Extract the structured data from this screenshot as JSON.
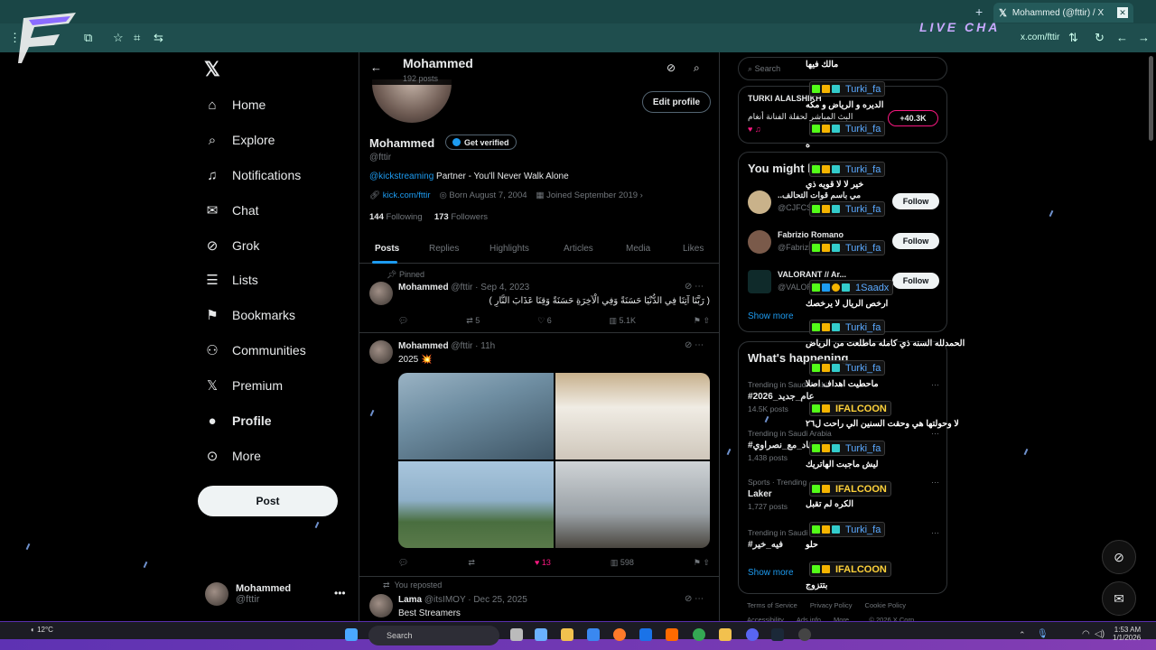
{
  "browser": {
    "tab_title": "Mohammed (@fttir) / X",
    "url": "x.com/fttir",
    "overlay_brand": "LIVE CHA"
  },
  "nav": {
    "items": [
      {
        "label": "Home",
        "icon": "home-icon"
      },
      {
        "label": "Explore",
        "icon": "search-icon"
      },
      {
        "label": "Notifications",
        "icon": "bell-icon"
      },
      {
        "label": "Chat",
        "icon": "mail-icon"
      },
      {
        "label": "Grok",
        "icon": "grok-icon"
      },
      {
        "label": "Lists",
        "icon": "list-icon"
      },
      {
        "label": "Bookmarks",
        "icon": "bookmark-icon"
      },
      {
        "label": "Communities",
        "icon": "communities-icon"
      },
      {
        "label": "Premium",
        "icon": "x-icon"
      },
      {
        "label": "Profile",
        "icon": "person-icon"
      },
      {
        "label": "More",
        "icon": "more-icon"
      }
    ],
    "post_label": "Post",
    "account_name": "Mohammed",
    "account_handle": "@fttir"
  },
  "profile": {
    "header_name": "Mohammed",
    "header_posts": "192 posts",
    "edit_label": "Edit profile",
    "name": "Mohammed",
    "verify_label": "Get verified",
    "handle": "@fttir",
    "bio_link": "@kickstreaming",
    "bio_text": " Partner - You'll Never Walk Alone",
    "website": "kick.com/fttir",
    "born": "Born August 7, 2004",
    "joined": "Joined September 2019",
    "following_count": "144",
    "following_label": " Following",
    "followers_count": "173",
    "followers_label": " Followers",
    "tabs": [
      "Posts",
      "Replies",
      "Highlights",
      "Articles",
      "Media",
      "Likes"
    ]
  },
  "tweets": {
    "pinned_label": "Pinned",
    "t1": {
      "name": "Mohammed",
      "meta": "@fttir · Sep 4, 2023",
      "text": "( رَبَّنَا آتِنَا فِي الدُّنْيَا حَسَنَةً وَفِي الْآخِرَةِ حَسَنَةً وَقِنَا عَذَابَ النَّارِ )",
      "replies": "",
      "reposts": "5",
      "likes": "6",
      "views": "5.1K"
    },
    "t2": {
      "name": "Mohammed",
      "meta": "@fttir · 11h",
      "text": "2025 💥",
      "replies": "",
      "reposts": "",
      "likes": "13",
      "views": "598"
    },
    "repost_label": "You reposted",
    "t3": {
      "name": "Lama",
      "meta": "@itsIMOY · Dec 25, 2025",
      "text": "Best Streamers"
    }
  },
  "right": {
    "search_placeholder": "Search",
    "live_title": "TURKI ALALSHIKH",
    "live_sub": "البث المباشر لحفلة الفنانة أنغام",
    "live_viewers": "+40.3K",
    "follow_heading": "You might like",
    "suggestions": [
      {
        "name": "..مي باسم قوات التحالف",
        "handle": "@CJFCS",
        "btn": "Follow"
      },
      {
        "name": "Fabrizio Romano",
        "handle": "@FabrizioRomano",
        "btn": "Follow"
      },
      {
        "name": "VALORANT // Ar...",
        "handle": "@VALORANTar",
        "btn": "Follow"
      }
    ],
    "show_more": "Show more",
    "trend_heading": "What's happening",
    "trends": [
      {
        "cat": "Trending in Saudi Arabia",
        "name": "#عام_جديد_2026",
        "cnt": "14.5K posts"
      },
      {
        "cat": "Trending in Saudi Arabia",
        "name": "#اسعاد_مع_نصراوي",
        "cnt": "1,438 posts"
      },
      {
        "cat": "Sports · Trending",
        "name": "Laker",
        "cnt": "1,727 posts"
      },
      {
        "cat": "Trending in Saudi Arabia",
        "name": "#فيه_خير",
        "cnt": ""
      }
    ],
    "show_more2": "Show more",
    "footer1": [
      "Terms of Service",
      "Privacy Policy",
      "Cookie Policy"
    ],
    "footer2": [
      "Accessibility",
      "Ads info",
      "More ...",
      "© 2026 X Corp."
    ]
  },
  "chat": [
    {
      "msg": "مالك فيها"
    },
    {
      "user": "Turki_fa",
      "msg": "الديره و الرياض و مكه"
    },
    {
      "user": "Turki_fa",
      "msg": "ه"
    },
    {
      "user": "Turki_fa",
      "msg": "خير لا لا قويه ذي"
    },
    {
      "user": "Turki_fa",
      "msg": ""
    },
    {
      "user": "Turki_fa",
      "msg": ""
    },
    {
      "user": "1Saadx",
      "msg": "ارخص الريال لا يرخصك"
    },
    {
      "user": "Turki_fa",
      "msg": "الحمدلله السنه ذي كامله ماطلعت من الرياض"
    },
    {
      "user": "Turki_fa",
      "msg": "ماحطيت اهداف اصلا"
    },
    {
      "user": "IFALCOON",
      "msg": "لا وحولتها هي وحقت السنين الي راحت ل٢٦"
    },
    {
      "user": "Turki_fa",
      "msg": "ليش ماجبت الهاتريك"
    },
    {
      "user": "IFALCOON",
      "msg": "الكره لم تقبل"
    },
    {
      "user": "Turki_fa",
      "msg": "حلو"
    },
    {
      "user": "IFALCOON",
      "msg": "بتتزوج"
    }
  ],
  "taskbar": {
    "temp": "12°C",
    "search": "Search",
    "time": "1:53 AM",
    "date": "1/1/2026"
  },
  "colors": {
    "accent": "#1d9bf0",
    "like": "#f91880",
    "browser_bar": "#1f4e4e"
  }
}
